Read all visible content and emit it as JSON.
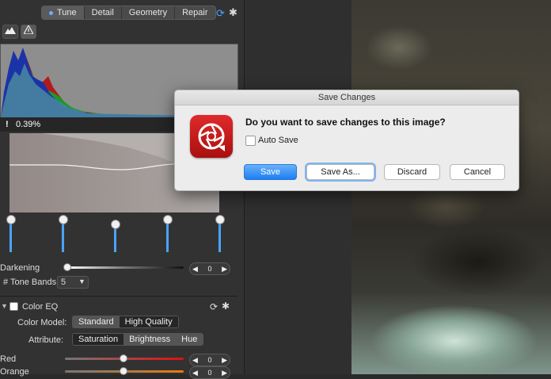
{
  "colors": {
    "accent": "#4aa3ff",
    "dialog_primary": "#1d7ef2",
    "app_icon": "#c41c1c"
  },
  "panel": {
    "tabs": [
      {
        "label": "Tune",
        "active": true
      },
      {
        "label": "Detail",
        "active": false
      },
      {
        "label": "Geometry",
        "active": false
      },
      {
        "label": "Repair",
        "active": false
      }
    ],
    "icons": {
      "refresh": "refresh-icon",
      "gear": "gear-icon",
      "mountain": "mountain-icon",
      "warning": "warning-triangle-icon"
    },
    "clip_indicator": "!",
    "clip_percent": "0.39%",
    "darkening": {
      "label": "Darkening",
      "value": "0"
    },
    "tone_bands": {
      "label": "# Tone Bands:",
      "value": "5"
    },
    "color_eq": {
      "label": "Color EQ",
      "model_label": "Color Model:",
      "model_options": [
        "Standard",
        "High Quality"
      ],
      "model_selected": "Standard",
      "attribute_label": "Attribute:",
      "attribute_options": [
        "Saturation",
        "Brightness",
        "Hue"
      ],
      "attribute_selected": "Saturation",
      "rows": [
        {
          "label": "Red",
          "value": "0"
        },
        {
          "label": "Orange",
          "value": "0"
        }
      ]
    }
  },
  "dialog": {
    "title": "Save Changes",
    "message": "Do you want to save changes to this image?",
    "auto_save_label": "Auto Save",
    "auto_save_checked": false,
    "buttons": {
      "save": "Save",
      "save_as": "Save As...",
      "discard": "Discard",
      "cancel": "Cancel"
    }
  }
}
